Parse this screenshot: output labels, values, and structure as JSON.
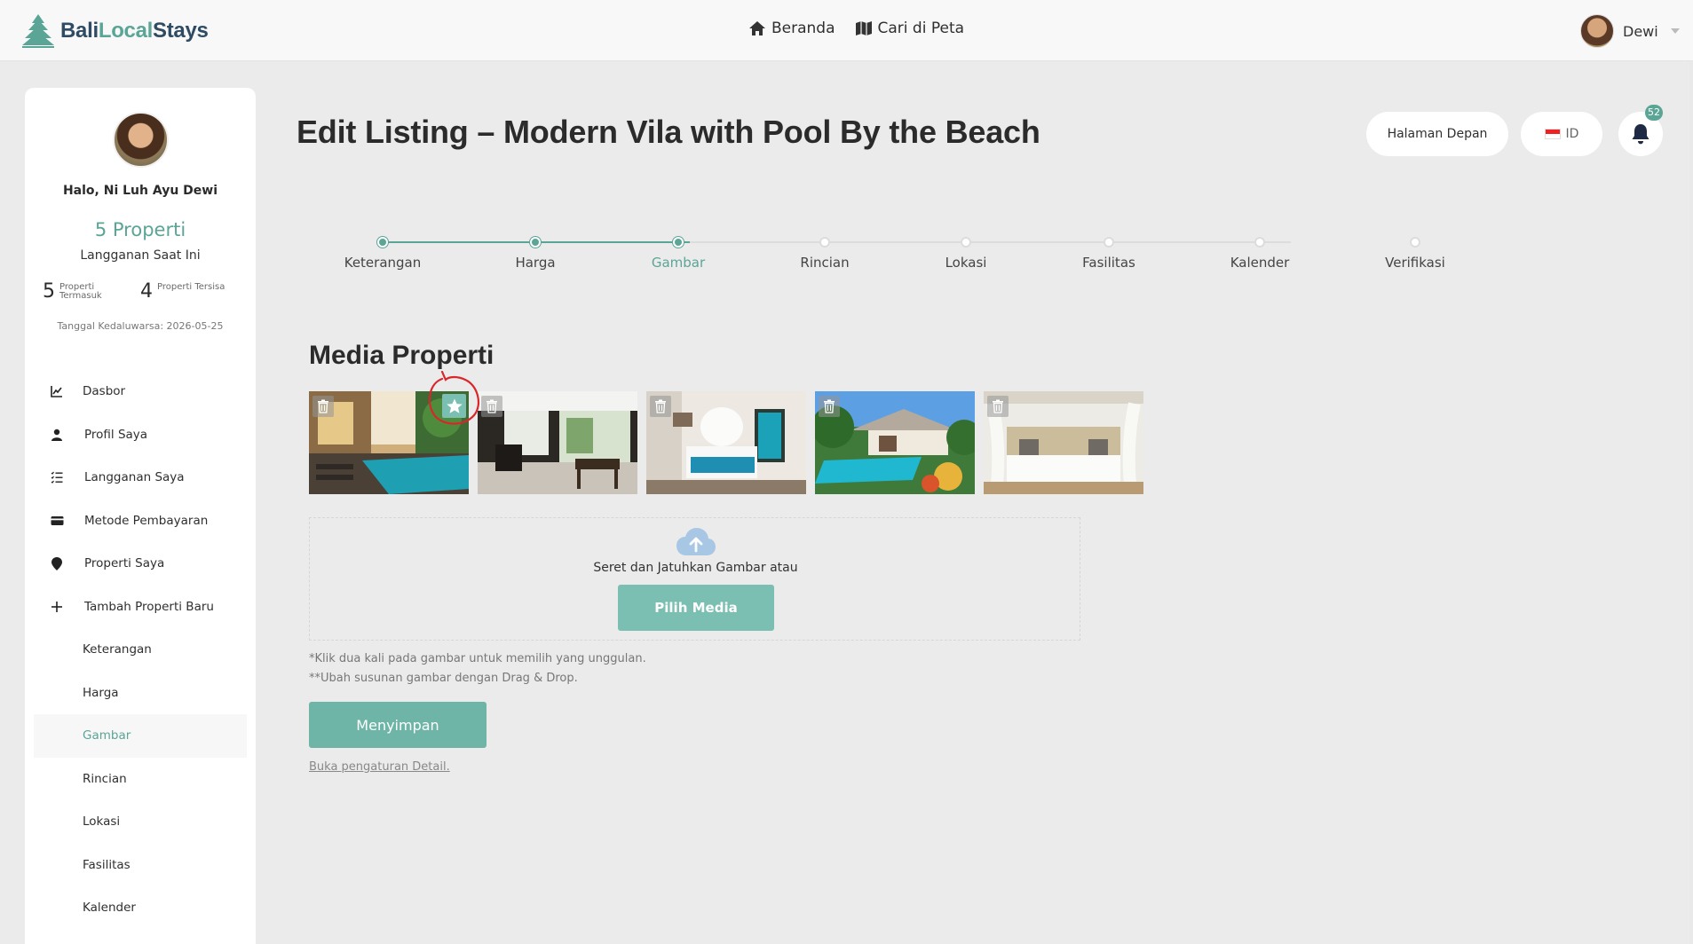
{
  "brand": {
    "part1": "Bali",
    "part2": "Local",
    "part3": "Stays",
    "icon": "pagoda-tree-icon"
  },
  "topnav": {
    "home_label": "Beranda",
    "map_label": "Cari di Peta"
  },
  "user": {
    "name": "Dewi"
  },
  "sidebar": {
    "greeting": "Halo, Ni Luh Ayu Dewi",
    "plan_count": "5 Properti",
    "plan_label": "Langganan Saat Ini",
    "stats": [
      {
        "value": "5",
        "label": "Properti Termasuk"
      },
      {
        "value": "4",
        "label": "Properti Tersisa"
      }
    ],
    "expiry": "Tanggal Kedaluwarsa: 2026-05-25",
    "items": [
      {
        "label": "Dasbor",
        "icon": "chart-line-icon"
      },
      {
        "label": "Profil Saya",
        "icon": "user-icon"
      },
      {
        "label": "Langganan Saya",
        "icon": "list-check-icon"
      },
      {
        "label": "Metode Pembayaran",
        "icon": "credit-card-icon"
      },
      {
        "label": "Properti Saya",
        "icon": "map-pin-icon"
      },
      {
        "label": "Tambah Properti Baru",
        "icon": "plus-icon"
      },
      {
        "label": "Keterangan"
      },
      {
        "label": "Harga"
      },
      {
        "label": "Gambar",
        "active": true
      },
      {
        "label": "Rincian"
      },
      {
        "label": "Lokasi"
      },
      {
        "label": "Fasilitas"
      },
      {
        "label": "Kalender"
      }
    ]
  },
  "header": {
    "title": "Edit Listing – Modern Vila with Pool By the Beach",
    "home_button": "Halaman Depan",
    "lang_label": "ID",
    "notification_count": "52"
  },
  "stepper": {
    "steps": [
      {
        "label": "Keterangan",
        "state": "done"
      },
      {
        "label": "Harga",
        "state": "done"
      },
      {
        "label": "Gambar",
        "state": "current"
      },
      {
        "label": "Rincian",
        "state": "todo"
      },
      {
        "label": "Lokasi",
        "state": "todo"
      },
      {
        "label": "Fasilitas",
        "state": "todo"
      },
      {
        "label": "Kalender",
        "state": "todo"
      },
      {
        "label": "Verifikasi",
        "state": "todo"
      }
    ]
  },
  "media": {
    "section_title": "Media Properti",
    "images": [
      {
        "name": "villa-pool",
        "featured": true
      },
      {
        "name": "living-room"
      },
      {
        "name": "bedroom-blue"
      },
      {
        "name": "garden-pool"
      },
      {
        "name": "canopy-bed"
      }
    ],
    "drop_text": "Seret dan Jatuhkan Gambar atau",
    "pick_button": "Pilih Media",
    "note1": "*Klik dua kali pada gambar untuk memilih yang unggulan.",
    "note2": "**Ubah susunan gambar dengan Drag & Drop."
  },
  "actions": {
    "save_button": "Menyimpan",
    "detail_link": "Buka pengaturan Detail."
  },
  "colors": {
    "accent": "#5aa596",
    "button": "#7abfb2",
    "background": "#ecebeb",
    "annotation": "#d9262a"
  }
}
